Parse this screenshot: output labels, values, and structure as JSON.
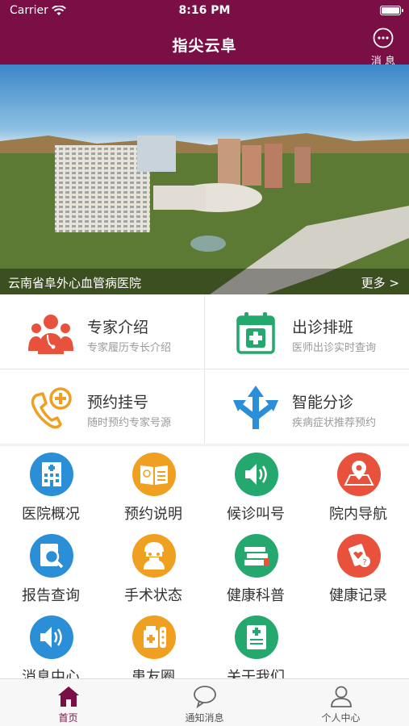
{
  "status_bar": {
    "carrier": "Carrier",
    "time": "8:16 PM"
  },
  "header": {
    "title": "指尖云阜",
    "message_label": "消 息"
  },
  "banner": {
    "caption": "云南省阜外心血管病医院",
    "more": "更多 >"
  },
  "features": [
    {
      "title": "专家介绍",
      "subtitle": "专家履历专长介绍",
      "icon": "doctors-group-icon",
      "color": "#e8513c"
    },
    {
      "title": "出诊排班",
      "subtitle": "医师出诊实时查询",
      "icon": "calendar-cross-icon",
      "color": "#25a86e"
    },
    {
      "title": "预约挂号",
      "subtitle": "随时预约专家号源",
      "icon": "phone-plus-icon",
      "color": "#f0a020"
    },
    {
      "title": "智能分诊",
      "subtitle": "疾病症状推荐预约",
      "icon": "triage-arrows-icon",
      "color": "#2b8fd8"
    }
  ],
  "grid": [
    {
      "label": "医院概况",
      "icon": "hospital-building-icon",
      "color": "#2b8fd8"
    },
    {
      "label": "预约说明",
      "icon": "open-book-icon",
      "color": "#f0a020"
    },
    {
      "label": "候诊叫号",
      "icon": "speaker-icon",
      "color": "#25a86e"
    },
    {
      "label": "院内导航",
      "icon": "map-pin-icon",
      "color": "#e8513c"
    },
    {
      "label": "报告查询",
      "icon": "report-search-icon",
      "color": "#2b8fd8"
    },
    {
      "label": "手术状态",
      "icon": "surgeon-icon",
      "color": "#f0a020"
    },
    {
      "label": "健康科普",
      "icon": "books-icon",
      "color": "#25a86e"
    },
    {
      "label": "健康记录",
      "icon": "clipboard-heart-icon",
      "color": "#e8513c"
    },
    {
      "label": "消息中心",
      "icon": "speaker-icon",
      "color": "#2b8fd8"
    },
    {
      "label": "患友圈",
      "icon": "medicine-bottle-icon",
      "color": "#f0a020"
    },
    {
      "label": "关于我们",
      "icon": "hospital-document-icon",
      "color": "#25a86e"
    }
  ],
  "tabs": [
    {
      "label": "首页",
      "icon": "home-icon",
      "active": true
    },
    {
      "label": "通知消息",
      "icon": "chat-bubble-icon",
      "active": false
    },
    {
      "label": "个人中心",
      "icon": "person-icon",
      "active": false
    }
  ],
  "colors": {
    "brand": "#7a0f45"
  }
}
